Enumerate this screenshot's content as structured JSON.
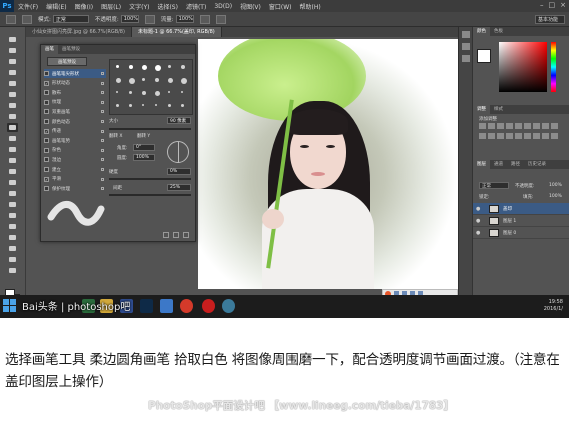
{
  "menubar": {
    "logo": "Ps",
    "items": [
      "文件(F)",
      "编辑(E)",
      "图像(I)",
      "图层(L)",
      "文字(Y)",
      "选择(S)",
      "滤镜(T)",
      "3D(D)",
      "视图(V)",
      "窗口(W)",
      "帮助(H)"
    ]
  },
  "options": {
    "mode_label": "模式:",
    "mode_value": "正常",
    "opacity_label": "不透明度:",
    "opacity_value": "100%",
    "flow_label": "流量:",
    "flow_value": "100%",
    "workspace": "基本功能"
  },
  "tabs": [
    {
      "label": "小仙女拼图闪亮屏.jpg @ 66.7%(RGB/8)",
      "active": false
    },
    {
      "label": "未标题-1 @ 66.7%(盖印, RGB/8)",
      "active": true
    }
  ],
  "brush_panel": {
    "tabs": [
      "画笔",
      "画笔预设"
    ],
    "preset_button": "画笔预设",
    "options": [
      {
        "label": "画笔笔尖形状",
        "checked": false,
        "active": true
      },
      {
        "label": "形状动态",
        "checked": true,
        "active": false
      },
      {
        "label": "散布",
        "checked": false,
        "active": false
      },
      {
        "label": "纹理",
        "checked": false,
        "active": false
      },
      {
        "label": "双重画笔",
        "checked": false,
        "active": false
      },
      {
        "label": "颜色动态",
        "checked": false,
        "active": false
      },
      {
        "label": "传递",
        "checked": true,
        "active": false
      },
      {
        "label": "画笔笔势",
        "checked": false,
        "active": false
      },
      {
        "label": "杂色",
        "checked": false,
        "active": false
      },
      {
        "label": "湿边",
        "checked": false,
        "active": false
      },
      {
        "label": "建立",
        "checked": false,
        "active": false
      },
      {
        "label": "平滑",
        "checked": true,
        "active": false
      },
      {
        "label": "保护纹理",
        "checked": false,
        "active": false
      }
    ],
    "size_label": "大小",
    "size_value": "90 像素",
    "flip_x": "翻转 X",
    "flip_y": "翻转 Y",
    "angle_label": "角度:",
    "angle_value": "0°",
    "roundness_label": "圆度:",
    "roundness_value": "100%",
    "hardness_label": "硬度",
    "hardness_value": "0%",
    "spacing_label": "间距",
    "spacing_value": "25%"
  },
  "right_dock": {
    "color_tabs": [
      "颜色",
      "色板"
    ],
    "adjust_tabs": [
      "调整",
      "样式"
    ],
    "adjust_hint": "添加调整",
    "layer_tabs": [
      "图层",
      "通道",
      "路径",
      "历史记录"
    ],
    "blend_mode": "正常",
    "opacity_label": "不透明度:",
    "opacity_value": "100%",
    "fill_label": "填充:",
    "fill_value": "100%",
    "lock_label": "锁定:",
    "layers": [
      {
        "name": "盖印",
        "selected": true
      },
      {
        "name": "图层 1",
        "selected": false
      },
      {
        "name": "图层 0",
        "selected": false
      }
    ]
  },
  "taskbar": {
    "time": "19:58",
    "date": "2016/1/"
  },
  "watermark": "Bai头条 | photoshop吧",
  "caption": "选择画笔工具 柔边圆角画笔 拾取白色 将图像周围磨一下，配合透明度调节画面过渡。（注意在盖印图层上操作）",
  "footer_watermark": "PhotoShop平面设计吧 【www.lineeg.com/tieba/1783】",
  "colors": {
    "ui_bg": "#535353",
    "selection": "#3b5b85",
    "brand": "#31a8ff"
  }
}
